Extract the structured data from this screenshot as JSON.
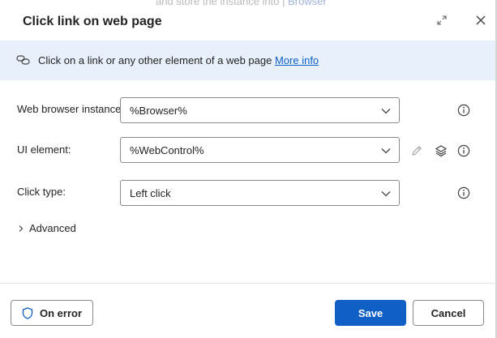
{
  "background_hint": {
    "text": "and store the instance into",
    "link": "Browser"
  },
  "dialog": {
    "title": "Click link on web page",
    "icons": {
      "expand": "expand-icon",
      "close": "close-icon"
    }
  },
  "info_bar": {
    "icon": "link-icon",
    "text": "Click on a link or any other element of a web page",
    "link_label": "More info"
  },
  "fields": [
    {
      "label": "Web browser instance:",
      "value": "%Browser%",
      "icons": [
        "info-icon"
      ]
    },
    {
      "label": "UI element:",
      "value": "%WebControl%",
      "icons": [
        "edit-pencil-icon",
        "layers-icon",
        "info-icon"
      ]
    },
    {
      "label": "Click type:",
      "value": "Left click",
      "icons": [
        "info-icon"
      ]
    }
  ],
  "advanced": {
    "label": "Advanced",
    "expanded": false
  },
  "footer": {
    "on_error_label": "On error",
    "save_label": "Save",
    "cancel_label": "Cancel"
  },
  "colors": {
    "accent": "#0f5fc5",
    "info_bar_bg": "#e8f1fb",
    "text": "#242424"
  }
}
